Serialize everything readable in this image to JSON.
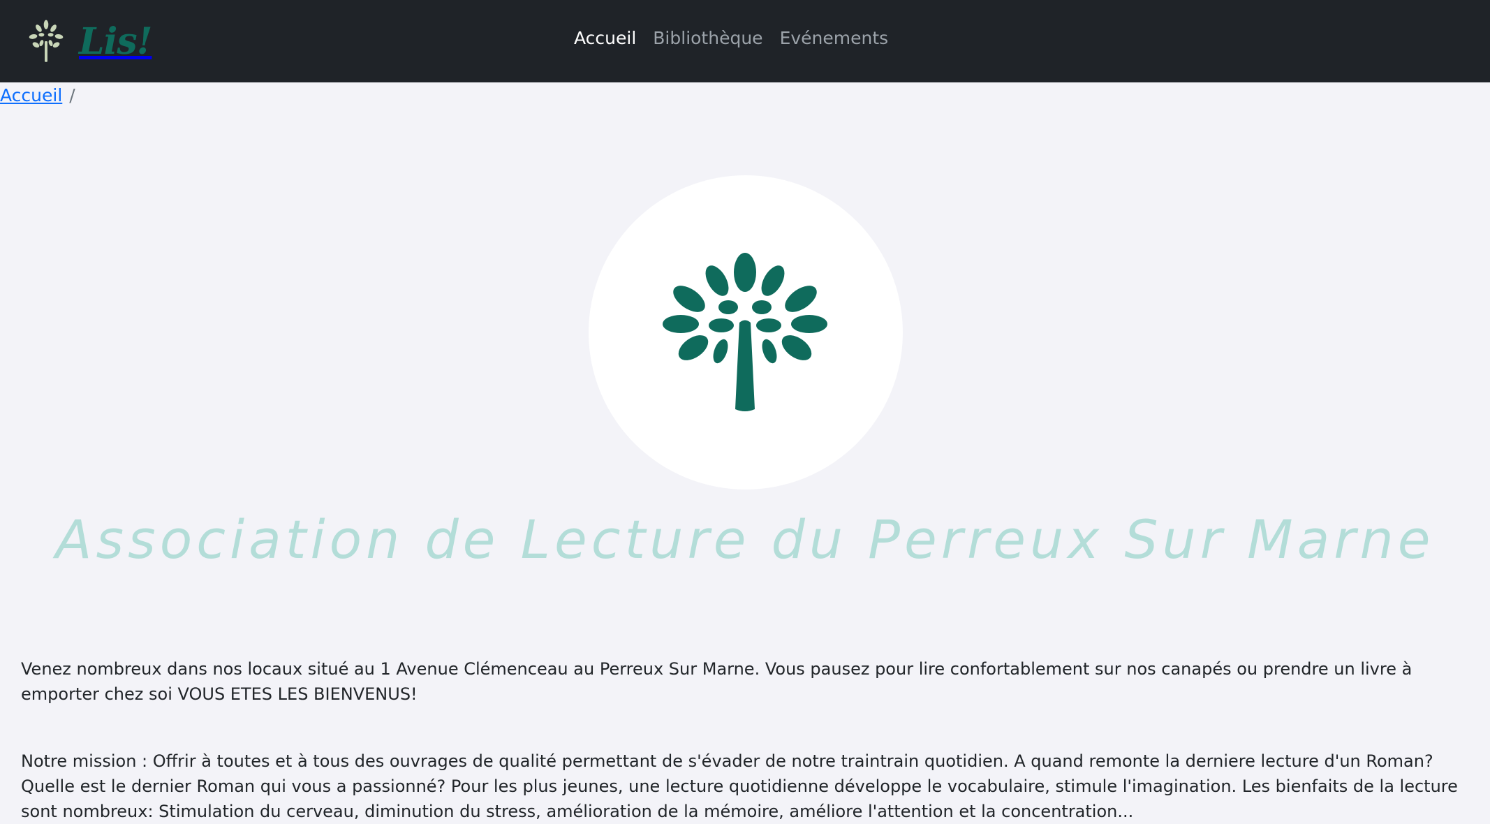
{
  "brand": {
    "logo_text": "Lis!",
    "logo_icon": "tree-icon"
  },
  "nav": {
    "items": [
      {
        "label": "Accueil",
        "active": true
      },
      {
        "label": "Bibliothèque",
        "active": false
      },
      {
        "label": "Evénements",
        "active": false
      }
    ]
  },
  "breadcrumb": {
    "home": "Accueil",
    "separator": "/"
  },
  "hero": {
    "icon": "tree-icon",
    "title": "Association de Lecture du Perreux Sur Marne"
  },
  "content": {
    "paragraph1": "Venez nombreux dans nos locaux situé au 1 Avenue Clémenceau au Perreux Sur Marne. Vous pausez pour lire confortablement sur nos canapés ou prendre un livre à emporter chez soi VOUS ETES LES BIENVENUS!",
    "paragraph2": "Notre mission : Offrir à toutes et à tous des ouvrages de qualité permettant de s'évader de notre traintrain quotidien. A quand remonte la derniere lecture d'un Roman? Quelle est le dernier Roman qui vous a passionné? Pour les plus jeunes, une lecture quotidienne développe le vocabulaire, stimule l'imagination. Les bienfaits de la lecture sont nombreux: Stimulation du cerveau, diminution du stress, amélioration de la mémoire, améliore l'attention et la concentration..."
  },
  "colors": {
    "navbar": "#1f2328",
    "brand_green": "#0f6b5c",
    "tree_light": "#c9d6b8",
    "title": "#b3ddd8",
    "page_bg": "#f3f3f8",
    "link": "#0d6efd"
  }
}
